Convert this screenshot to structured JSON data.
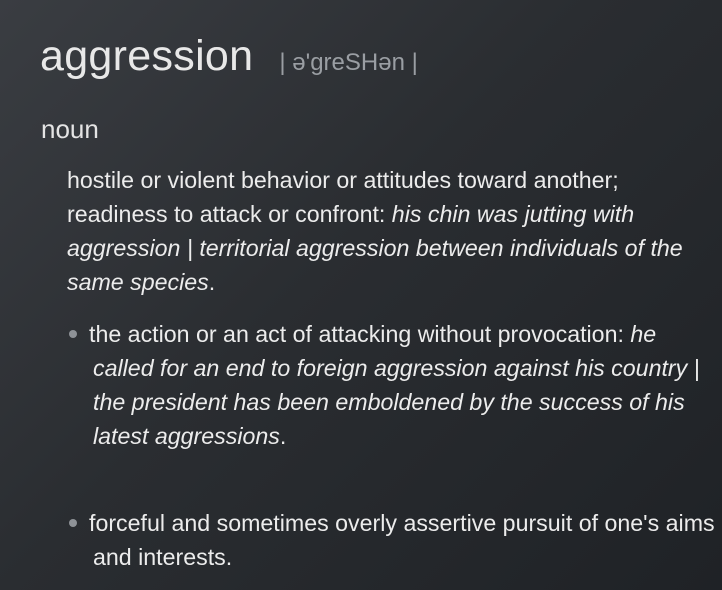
{
  "entry": {
    "headword": "aggression",
    "pronunciation": "| ə'greSHən |",
    "part_of_speech": "noun"
  },
  "senses": [
    {
      "definition": "hostile or violent behavior or attitudes toward another; readiness to attack or confront: ",
      "example": "his chin was jutting with aggression | territorial aggression between individuals of the same species",
      "end": "."
    }
  ],
  "subsenses": [
    {
      "definition": "the action or an act of attacking without provocation: ",
      "example": "he called for an end to foreign aggression against his country | the president has been emboldened by the success of his latest aggressions",
      "end": "."
    },
    {
      "definition": "forceful and sometimes overly assertive pursuit of one's aims and interests.",
      "example": "",
      "end": ""
    }
  ]
}
